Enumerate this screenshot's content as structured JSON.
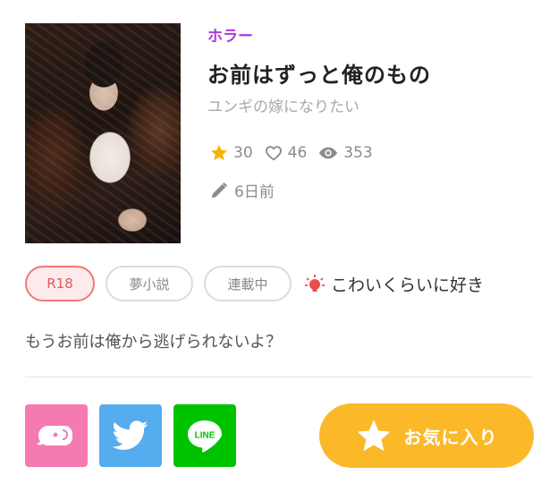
{
  "story": {
    "genre": "ホラー",
    "title": "お前はずっと俺のもの",
    "author": "ユンギの嫁になりたい",
    "stars": "30",
    "likes": "46",
    "views": "353",
    "updated": "6日前"
  },
  "tags": [
    "R18",
    "夢小説",
    "連載中"
  ],
  "mood": {
    "label": "こわいくらいに好き",
    "icon": "lightbulb-icon",
    "color": "#e84e4e"
  },
  "description": "もうお前は俺から逃げられないよ？",
  "share": {
    "line_label": "LINE",
    "colors": {
      "elephant": "#f57ab2",
      "twitter": "#55acee",
      "line": "#00c300"
    }
  },
  "favorite": {
    "label": "お気に入り",
    "color": "#fbb929"
  }
}
